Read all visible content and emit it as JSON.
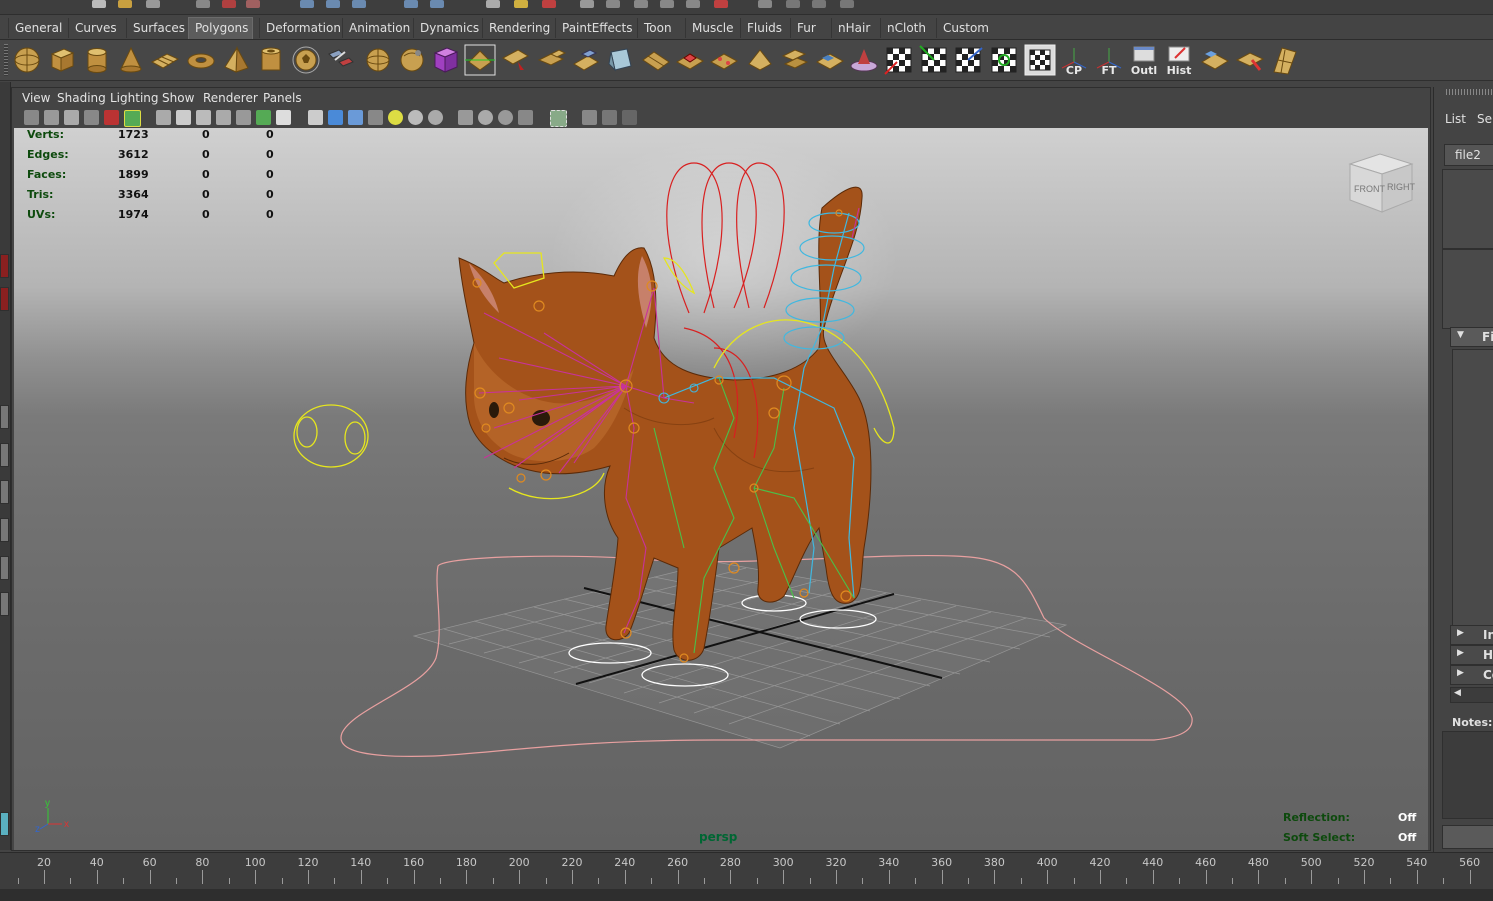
{
  "shelf_tabs": [
    "General",
    "Curves",
    "Surfaces",
    "Polygons",
    "Deformation",
    "Animation",
    "Dynamics",
    "Rendering",
    "PaintEffects",
    "Toon",
    "Muscle",
    "Fluids",
    "Fur",
    "nHair",
    "nCloth",
    "Custom"
  ],
  "active_shelf_tab": "Polygons",
  "shelf_labeled_buttons": {
    "cp": "CP",
    "ft": "FT",
    "outl": "Outl",
    "hist": "Hist"
  },
  "panel_menu": [
    "View",
    "Shading",
    "Lighting",
    "Show",
    "Renderer",
    "Panels"
  ],
  "heads_up": {
    "poly_count": [
      {
        "label": "Verts:",
        "values": [
          "1723",
          "0",
          "0"
        ]
      },
      {
        "label": "Edges:",
        "values": [
          "3612",
          "0",
          "0"
        ]
      },
      {
        "label": "Faces:",
        "values": [
          "1899",
          "0",
          "0"
        ]
      },
      {
        "label": "Tris:",
        "values": [
          "3364",
          "0",
          "0"
        ]
      },
      {
        "label": "UVs:",
        "values": [
          "1974",
          "0",
          "0"
        ]
      }
    ],
    "reflection_label": "Reflection:",
    "reflection_value": "Off",
    "soft_select_label": "Soft Select:",
    "soft_select_value": "Off",
    "camera_name": "persp"
  },
  "view_cube": {
    "front": "FRONT",
    "right": "RIGHT"
  },
  "axis": {
    "x": "x",
    "y": "y",
    "z": "z"
  },
  "timeline": {
    "labels": [
      "20",
      "40",
      "60",
      "80",
      "100",
      "120",
      "140",
      "160",
      "180",
      "200",
      "220",
      "240",
      "260",
      "280",
      "300",
      "320",
      "340",
      "360",
      "380",
      "400",
      "420",
      "440",
      "460",
      "480",
      "500",
      "520",
      "540",
      "560"
    ]
  },
  "right_panel": {
    "list_label": "List",
    "select_label": "Sel",
    "node_tab": "file2",
    "section_open": "Fi",
    "section_1": "In",
    "section_2": "Hi",
    "section_3": "Co",
    "notes_label": "Notes:"
  },
  "colors": {
    "hud_label": "#0d4a0d",
    "rig_magenta": "#c8329a",
    "rig_yellow": "#e6e61e",
    "rig_red": "#d82020",
    "rig_cyan": "#40b8e0",
    "rig_green": "#4ac04a",
    "fur": "#a4521a",
    "outline_pink": "#e8a0a0"
  }
}
